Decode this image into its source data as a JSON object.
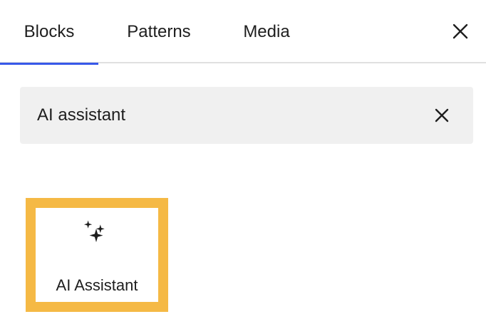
{
  "tabs": [
    {
      "label": "Blocks",
      "active": true
    },
    {
      "label": "Patterns",
      "active": false
    },
    {
      "label": "Media",
      "active": false
    }
  ],
  "accent_color": "#3858e9",
  "highlight_color": "#f5b945",
  "close_icon": "close-icon",
  "search": {
    "value": "AI assistant",
    "clear_icon": "close-icon"
  },
  "results": [
    {
      "label": "AI Assistant",
      "icon": "sparkles-icon"
    }
  ]
}
